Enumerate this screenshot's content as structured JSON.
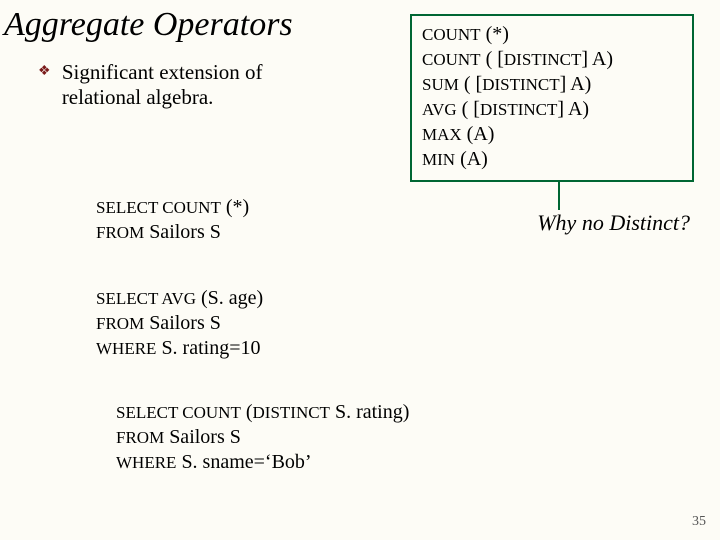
{
  "title": "Aggregate Operators",
  "bullet": "Significant extension of relational algebra.",
  "agg_box": {
    "l1a": "COUNT",
    "l1b": " (*)",
    "l2a": "COUNT",
    "l2b": " ( [",
    "l2c": "DISTINCT",
    "l2d": "] A)",
    "l3a": "SUM",
    "l3b": " ( [",
    "l3c": "DISTINCT",
    "l3d": "] A)",
    "l4a": "AVG",
    "l4b": " ( [",
    "l4c": "DISTINCT",
    "l4d": "] A)",
    "l5a": "MAX",
    "l5b": " (A)",
    "l6a": "MIN",
    "l6b": " (A)"
  },
  "why": "Why no Distinct?",
  "code1": {
    "l1a": "SELECT  COUNT",
    "l1b": " (*)",
    "l2a": "FROM",
    "l2b": "  Sailors S"
  },
  "code2": {
    "l1a": "SELECT  AVG",
    "l1b": " (S. age)",
    "l2a": "FROM",
    "l2b": "  Sailors S",
    "l3a": "WHERE",
    "l3b": "  S. rating=10"
  },
  "code3": {
    "l1a": "SELECT  COUNT",
    "l1b": " (",
    "l1c": "DISTINCT",
    "l1d": " S. rating)",
    "l2a": "FROM",
    "l2b": "  Sailors S",
    "l3a": "WHERE",
    "l3b": " S. sname=‘Bob’"
  },
  "page": "35"
}
